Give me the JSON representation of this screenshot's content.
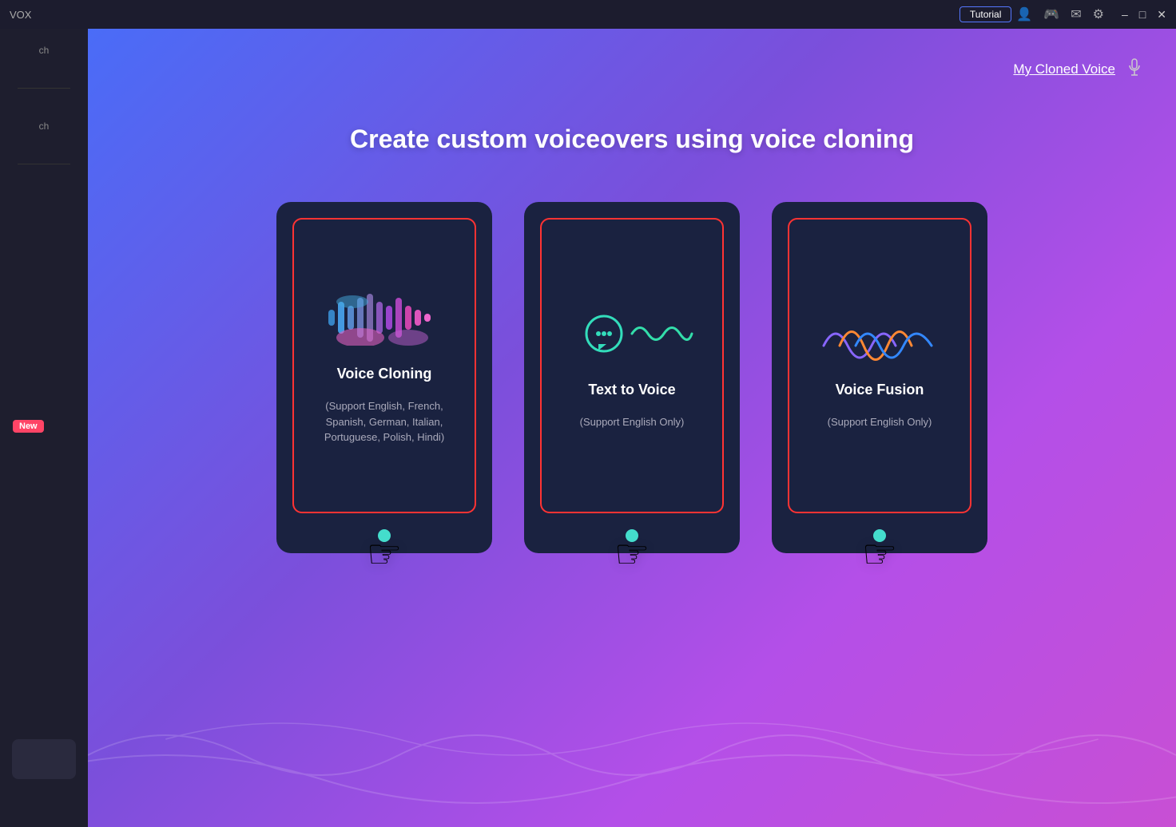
{
  "titlebar": {
    "app_name": "VOX",
    "tutorial_label": "Tutorial",
    "window_controls": {
      "minimize": "—",
      "maximize": "□",
      "close": "✕"
    }
  },
  "topright": {
    "my_cloned_voice_label": "My Cloned Voice"
  },
  "page": {
    "title": "Create custom voiceovers using voice cloning"
  },
  "sidebar": {
    "new_badge": "New"
  },
  "cards": [
    {
      "id": "voice-cloning",
      "title": "Voice Cloning",
      "subtitle": "(Support English, French, Spanish, German, Italian, Portuguese, Polish, Hindi)"
    },
    {
      "id": "text-to-voice",
      "title": "Text to Voice",
      "subtitle": "(Support English Only)"
    },
    {
      "id": "voice-fusion",
      "title": "Voice Fusion",
      "subtitle": "(Support English Only)"
    }
  ]
}
